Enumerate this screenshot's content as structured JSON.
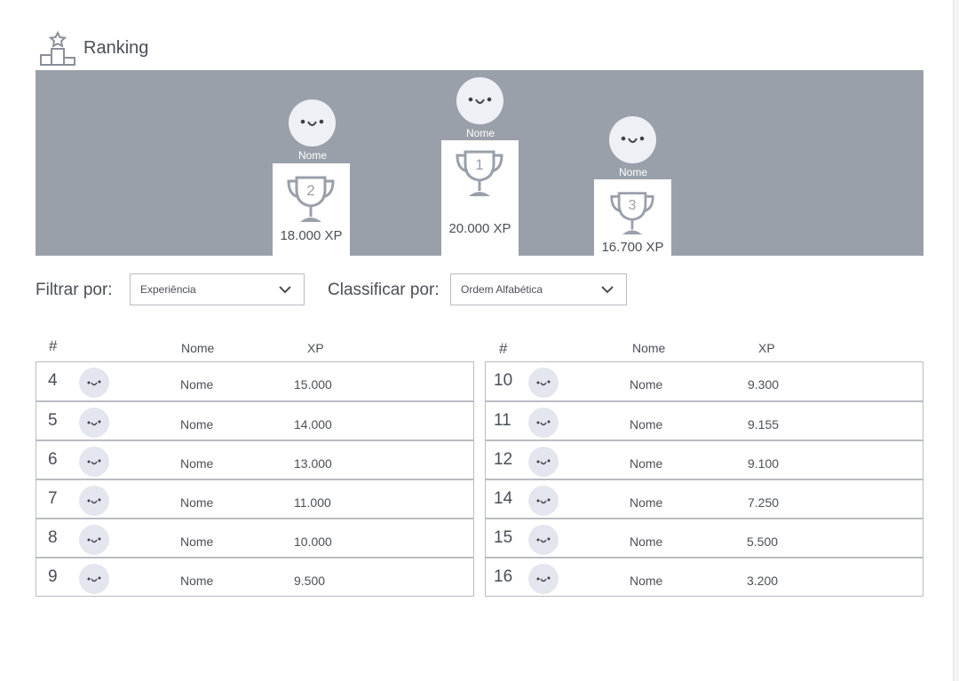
{
  "page": {
    "title": "Ranking"
  },
  "podium": {
    "first": {
      "position": "1",
      "name": "Nome",
      "xp": "20.000 XP"
    },
    "second": {
      "position": "2",
      "name": "Nome",
      "xp": "18.000 XP"
    },
    "third": {
      "position": "3",
      "name": "Nome",
      "xp": "16.700 XP"
    }
  },
  "filters": {
    "filter_label": "Filtrar por:",
    "filter_value": "Experiência",
    "sort_label": "Classificar por:",
    "sort_value": "Ordem Alfabética"
  },
  "table_headers": {
    "rank": "#",
    "name": "Nome",
    "xp": "XP"
  },
  "left_table": [
    {
      "rank": "4",
      "name": "Nome",
      "xp": "15.000"
    },
    {
      "rank": "5",
      "name": "Nome",
      "xp": "14.000"
    },
    {
      "rank": "6",
      "name": "Nome",
      "xp": "13.000"
    },
    {
      "rank": "7",
      "name": "Nome",
      "xp": "11.000"
    },
    {
      "rank": "8",
      "name": "Nome",
      "xp": "10.000"
    },
    {
      "rank": "9",
      "name": "Nome",
      "xp": "9.500"
    }
  ],
  "right_table": [
    {
      "rank": "10",
      "name": "Nome",
      "xp": "9.300"
    },
    {
      "rank": "11",
      "name": "Nome",
      "xp": "9.155"
    },
    {
      "rank": "12",
      "name": "Nome",
      "xp": "9.100"
    },
    {
      "rank": "14",
      "name": "Nome",
      "xp": "7.250"
    },
    {
      "rank": "15",
      "name": "Nome",
      "xp": "5.500"
    },
    {
      "rank": "16",
      "name": "Nome",
      "xp": "3.200"
    }
  ],
  "icons": {
    "title": "podium-icon",
    "trophy": "trophy-icon",
    "avatar": "smiley-avatar-icon",
    "dropdown": "chevron-down-icon"
  },
  "colors": {
    "podium_bg": "#9aa0aa",
    "avatar_bg": "#eef0f5",
    "text": "#4a4f57",
    "border": "#b9bcc2"
  }
}
